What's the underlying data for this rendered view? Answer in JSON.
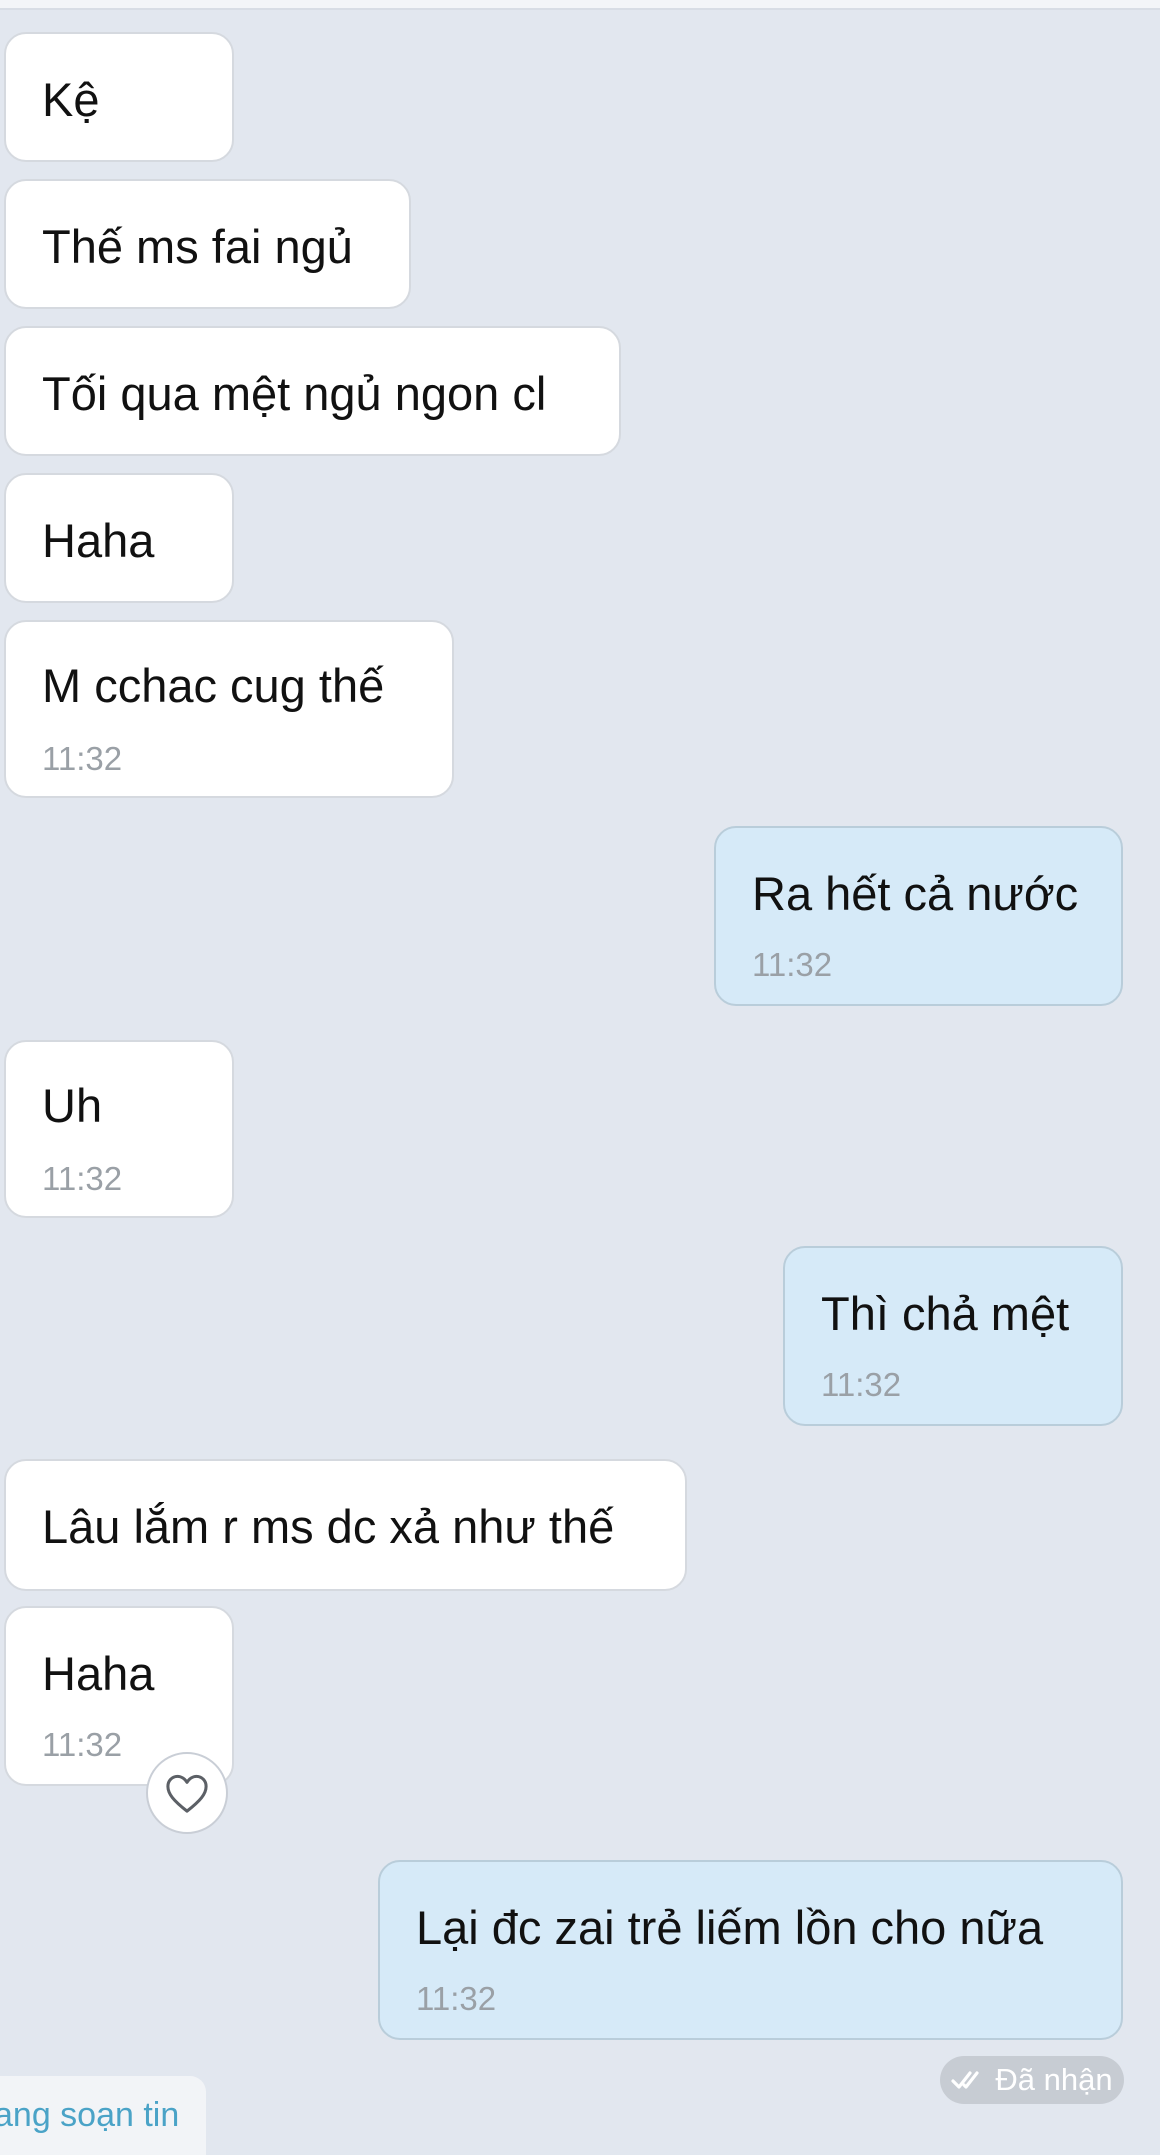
{
  "chat": {
    "messages": [
      {
        "side": "in",
        "text": "Kệ",
        "time": ""
      },
      {
        "side": "in",
        "text": "Thế ms fai ngủ",
        "time": ""
      },
      {
        "side": "in",
        "text": "Tối qua mệt ngủ ngon cl",
        "time": ""
      },
      {
        "side": "in",
        "text": "Haha",
        "time": ""
      },
      {
        "side": "in",
        "text": "M cchac cug thế",
        "time": "11:32"
      },
      {
        "side": "out",
        "text": "Ra hết cả nước",
        "time": "11:32"
      },
      {
        "side": "in",
        "text": "Uh",
        "time": "11:32"
      },
      {
        "side": "out",
        "text": "Thì chả mệt",
        "time": "11:32"
      },
      {
        "side": "in",
        "text": "Lâu lắm r ms dc xả như thế",
        "time": ""
      },
      {
        "side": "in",
        "text": "Haha",
        "time": "11:32"
      },
      {
        "side": "out",
        "text": "Lại đc zai trẻ liếm lồn cho nữa",
        "time": "11:32"
      }
    ],
    "reaction_icon": "heart-outline-icon",
    "receipt_label": "Đã nhận",
    "receipt_icon": "double-check-icon",
    "typing_status": "ang soạn tin"
  },
  "colors": {
    "background": "#e2e7ef",
    "incoming_bubble": "#ffffff",
    "outgoing_bubble": "#d6eaf8",
    "timestamp": "#9aa0a6",
    "typing_text": "#4aa3c7"
  }
}
